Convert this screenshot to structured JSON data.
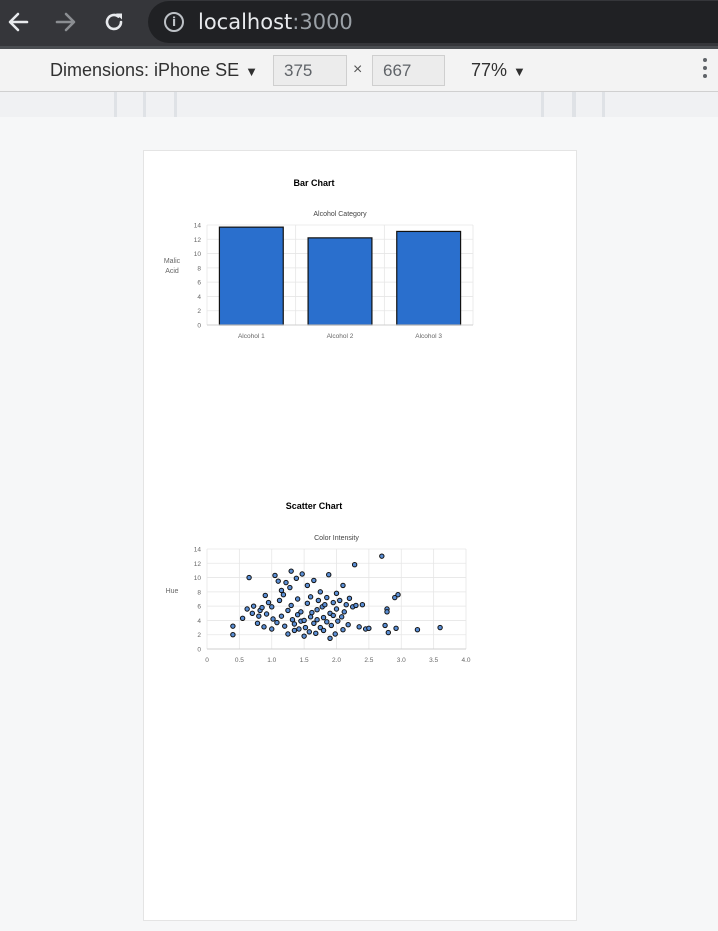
{
  "browser": {
    "url_host": "localhost",
    "url_port": ":3000"
  },
  "devtools": {
    "device_label": "Dimensions: iPhone SE",
    "width_value": "375",
    "height_value": "667",
    "times_sign": "×",
    "zoom_label": "77%"
  },
  "page": {
    "bar_heading": "Bar Chart",
    "scatter_heading": "Scatter Chart"
  },
  "colors": {
    "bar_fill": "#2a6fcd",
    "point_fill": "#5b8fd6",
    "topbar": "#35363a",
    "omnibox": "#202124"
  },
  "chart_data": [
    {
      "type": "bar",
      "title": "Alcohol Category",
      "ylabel": "Malic Acid",
      "ylabel_lines": [
        "Malic",
        "Acid"
      ],
      "categories": [
        "Alcohol 1",
        "Alcohol 2",
        "Alcohol 3"
      ],
      "values": [
        13.7,
        12.2,
        13.1
      ],
      "ylim": [
        0,
        14
      ],
      "yticks": [
        "0",
        "2",
        "4",
        "6",
        "8",
        "10",
        "12",
        "14"
      ],
      "grid": true,
      "legend": "none"
    },
    {
      "type": "scatter",
      "title": "Color Intensity",
      "ylabel": "Hue",
      "xlim": [
        0,
        4
      ],
      "ylim": [
        0,
        14
      ],
      "xticks": [
        "0",
        "0.5",
        "1.0",
        "1.5",
        "2.0",
        "2.5",
        "3.0",
        "3.5",
        "4.0"
      ],
      "yticks": [
        "0",
        "2",
        "4",
        "6",
        "8",
        "10",
        "12",
        "14"
      ],
      "grid": true,
      "legend": "none",
      "points": [
        [
          0.4,
          2.0
        ],
        [
          0.4,
          3.2
        ],
        [
          0.55,
          4.3
        ],
        [
          0.65,
          10.0
        ],
        [
          0.62,
          5.6
        ],
        [
          0.7,
          5.0
        ],
        [
          0.72,
          6.0
        ],
        [
          0.78,
          3.6
        ],
        [
          0.8,
          4.6
        ],
        [
          0.82,
          5.4
        ],
        [
          0.85,
          5.8
        ],
        [
          0.88,
          3.1
        ],
        [
          0.9,
          7.5
        ],
        [
          0.92,
          4.9
        ],
        [
          0.95,
          6.5
        ],
        [
          1.0,
          5.9
        ],
        [
          1.0,
          2.8
        ],
        [
          1.02,
          4.2
        ],
        [
          1.05,
          10.3
        ],
        [
          1.08,
          3.7
        ],
        [
          1.1,
          9.5
        ],
        [
          1.12,
          6.8
        ],
        [
          1.15,
          4.6
        ],
        [
          1.15,
          8.2
        ],
        [
          1.18,
          7.6
        ],
        [
          1.2,
          3.2
        ],
        [
          1.22,
          9.3
        ],
        [
          1.25,
          2.1
        ],
        [
          1.25,
          5.4
        ],
        [
          1.28,
          8.6
        ],
        [
          1.3,
          6.1
        ],
        [
          1.3,
          10.9
        ],
        [
          1.32,
          4.1
        ],
        [
          1.35,
          2.6
        ],
        [
          1.35,
          3.5
        ],
        [
          1.38,
          9.9
        ],
        [
          1.4,
          7.0
        ],
        [
          1.4,
          4.8
        ],
        [
          1.42,
          2.8
        ],
        [
          1.45,
          3.9
        ],
        [
          1.45,
          5.2
        ],
        [
          1.47,
          10.5
        ],
        [
          1.5,
          1.8
        ],
        [
          1.5,
          4.0
        ],
        [
          1.52,
          3.0
        ],
        [
          1.55,
          8.9
        ],
        [
          1.55,
          6.4
        ],
        [
          1.58,
          2.4
        ],
        [
          1.6,
          4.5
        ],
        [
          1.6,
          7.3
        ],
        [
          1.62,
          5.1
        ],
        [
          1.65,
          3.6
        ],
        [
          1.65,
          9.6
        ],
        [
          1.68,
          2.2
        ],
        [
          1.7,
          5.5
        ],
        [
          1.7,
          4.1
        ],
        [
          1.72,
          6.8
        ],
        [
          1.75,
          3.0
        ],
        [
          1.75,
          8.0
        ],
        [
          1.78,
          5.9
        ],
        [
          1.8,
          4.4
        ],
        [
          1.8,
          2.6
        ],
        [
          1.82,
          6.2
        ],
        [
          1.85,
          3.8
        ],
        [
          1.85,
          7.2
        ],
        [
          1.88,
          10.4
        ],
        [
          1.9,
          5.0
        ],
        [
          1.9,
          1.5
        ],
        [
          1.92,
          3.3
        ],
        [
          1.95,
          6.5
        ],
        [
          1.95,
          4.7
        ],
        [
          1.98,
          2.1
        ],
        [
          2.0,
          5.6
        ],
        [
          2.0,
          7.8
        ],
        [
          2.02,
          3.9
        ],
        [
          2.05,
          6.8
        ],
        [
          2.08,
          4.5
        ],
        [
          2.1,
          2.7
        ],
        [
          2.1,
          8.9
        ],
        [
          2.12,
          5.2
        ],
        [
          2.15,
          6.2
        ],
        [
          2.18,
          3.4
        ],
        [
          2.2,
          7.1
        ],
        [
          2.25,
          5.9
        ],
        [
          2.28,
          11.8
        ],
        [
          2.3,
          6.1
        ],
        [
          2.35,
          3.1
        ],
        [
          2.4,
          6.2
        ],
        [
          2.45,
          2.8
        ],
        [
          2.5,
          2.9
        ],
        [
          2.7,
          13.0
        ],
        [
          2.75,
          3.3
        ],
        [
          2.78,
          5.6
        ],
        [
          2.78,
          5.2
        ],
        [
          2.8,
          2.3
        ],
        [
          2.9,
          7.2
        ],
        [
          2.92,
          2.9
        ],
        [
          2.95,
          7.6
        ],
        [
          3.25,
          2.7
        ],
        [
          3.6,
          3.0
        ]
      ]
    }
  ]
}
